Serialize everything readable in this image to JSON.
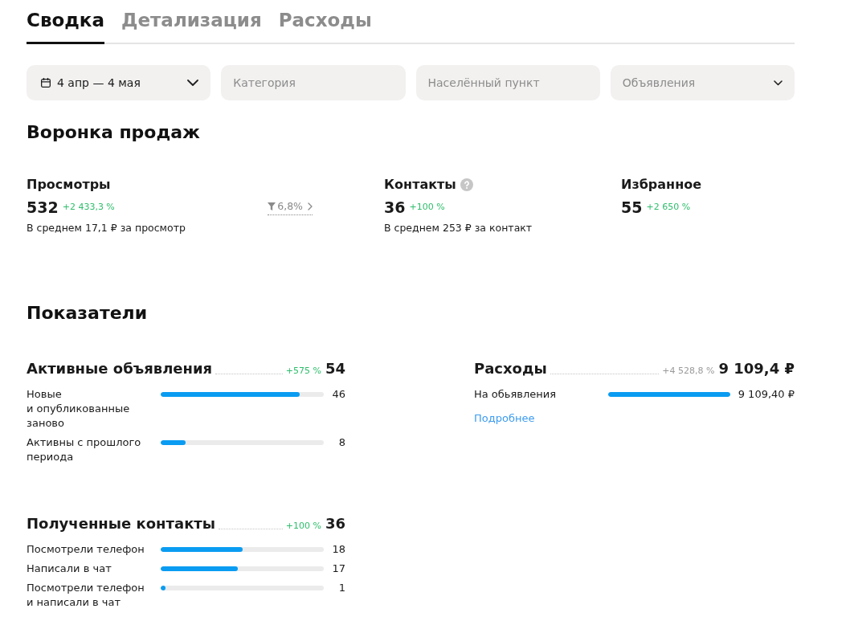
{
  "tabs": [
    {
      "label": "Сводка",
      "selected": true
    },
    {
      "label": "Детализация",
      "selected": false
    },
    {
      "label": "Расходы",
      "selected": false
    }
  ],
  "filters": [
    {
      "kind": "date",
      "value": "4 апр — 4 мая"
    },
    {
      "kind": "input",
      "placeholder": "Категория"
    },
    {
      "kind": "input",
      "placeholder": "Населённый пункт"
    },
    {
      "kind": "select",
      "placeholder": "Объявления"
    }
  ],
  "funnel": {
    "title": "Воронка продаж",
    "metrics": [
      {
        "label": "Просмотры",
        "help": false,
        "value": "532",
        "change": "+2 433,3 %",
        "positive": true,
        "note": "В среднем 17,1 ₽ за просмотр",
        "conversion": "6,8%"
      },
      {
        "label": "Контакты",
        "help": true,
        "value": "36",
        "change": "+100 %",
        "positive": true,
        "note": "В среднем 253 ₽ за контакт"
      },
      {
        "label": "Избранное",
        "help": false,
        "value": "55",
        "change": "+2 650 %",
        "positive": true
      }
    ]
  },
  "indicators": {
    "title": "Показатели",
    "groups": [
      {
        "title": "Активные объявления",
        "change": "+575 %",
        "positive": true,
        "total": "54",
        "rows": [
          {
            "label": "Новые и опубликованные заново",
            "level": 0.85,
            "value": "46"
          },
          {
            "label": "Активны с прошлого периода",
            "level": 0.15,
            "value": "8"
          }
        ]
      },
      {
        "title": "Расходы",
        "change": "+4 528,8 %",
        "positive": false,
        "total": "9 109,4 ₽",
        "rows": [
          {
            "label": "На обьявления",
            "level": 1,
            "value": "9 109,40 ₽"
          }
        ],
        "link": "Подробнее"
      },
      {
        "title": "Полученные контакты",
        "change": "+100 %",
        "positive": true,
        "total": "36",
        "rows": [
          {
            "label": "Посмотрели телефон",
            "level": 0.5,
            "value": "18"
          },
          {
            "label": "Написали в чат",
            "level": 0.47,
            "value": "17"
          },
          {
            "label": "Посмотрели телефон и написали в чат",
            "level": 0.03,
            "value": "1"
          }
        ]
      }
    ]
  }
}
